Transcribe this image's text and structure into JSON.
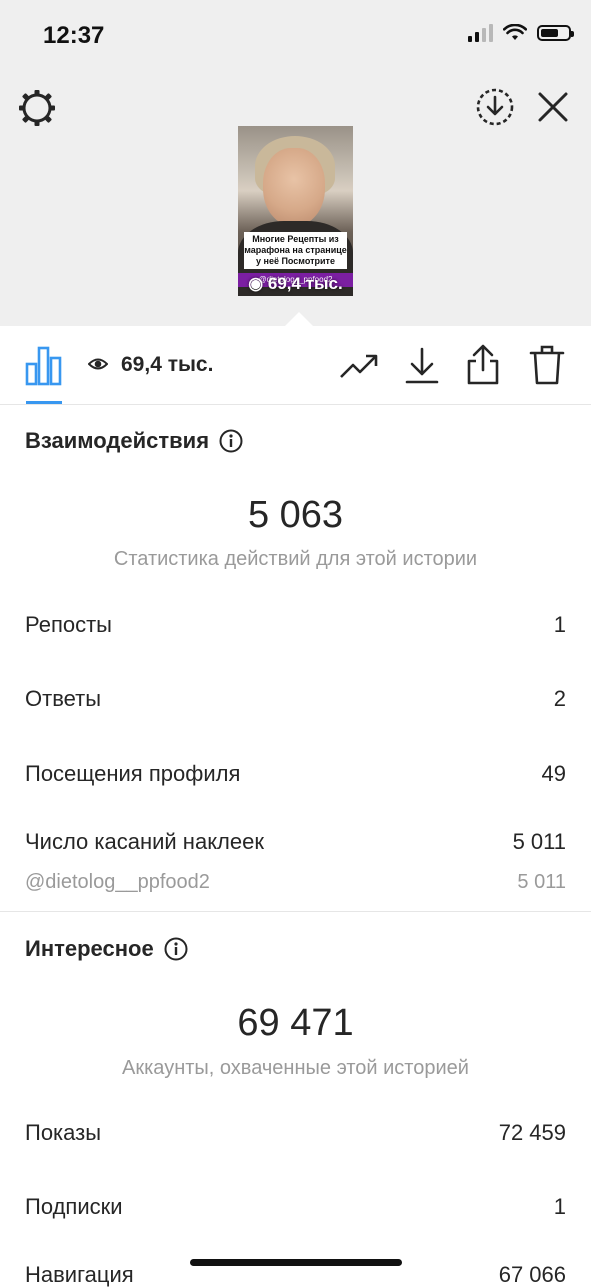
{
  "status_bar": {
    "time": "12:37"
  },
  "preview": {
    "caption": "Многие Рецепты из марафона на странице у неё Посмотрите",
    "mention_tag": "@dietolog__ppfood2",
    "views_overlay": "69,4 тыс."
  },
  "toolbar": {
    "views": "69,4 тыс."
  },
  "interactions": {
    "title": "Взаимодействия",
    "total": "5 063",
    "caption": "Статистика действий для этой истории",
    "rows": [
      {
        "label": "Репосты",
        "value": "1"
      },
      {
        "label": "Ответы",
        "value": "2"
      },
      {
        "label": "Посещения профиля",
        "value": "49"
      },
      {
        "label": "Число касаний наклеек",
        "value": "5 011"
      }
    ],
    "sub_row": {
      "label": "@dietolog__ppfood2",
      "value": "5 011"
    }
  },
  "discovery": {
    "title": "Интересное",
    "total": "69 471",
    "caption": "Аккаунты, охваченные этой историей",
    "rows": [
      {
        "label": "Показы",
        "value": "72 459"
      },
      {
        "label": "Подписки",
        "value": "1"
      },
      {
        "label": "Навигация",
        "value": "67 066"
      }
    ]
  },
  "colors": {
    "accent": "#3897f0",
    "text": "#262626",
    "muted": "#9a9a9a",
    "tag": "#7b1fa2"
  }
}
